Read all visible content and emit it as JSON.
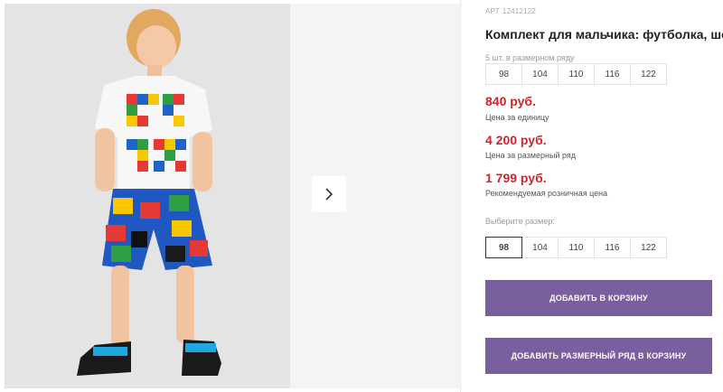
{
  "product": {
    "art_label": "АРТ",
    "art_number": "12412122",
    "title": "Комплект для мальчика: футболка, шорты",
    "row_note": "5 шт. в размерном ряду",
    "row_sizes": [
      "98",
      "104",
      "110",
      "116",
      "122"
    ]
  },
  "prices": {
    "unit_price": "840 руб.",
    "unit_label": "Цена за единицу",
    "row_price": "4 200 руб.",
    "row_label": "Цена за размерный ряд",
    "retail_price": "1 799 руб.",
    "retail_label": "Рекомендуемая розничная цена"
  },
  "size_select": {
    "label": "Выберите размер:",
    "options": [
      "98",
      "104",
      "110",
      "116",
      "122"
    ],
    "selected": "98"
  },
  "buttons": {
    "add_to_cart": "ДОБАВИТЬ В КОРЗИНУ",
    "add_row_to_cart": "ДОБАВИТЬ РАЗМЕРНЫЙ РЯД В КОРЗИНУ"
  },
  "gallery": {
    "next_icon": "chevron-right-icon"
  },
  "colors": {
    "accent": "#7a5f9e",
    "price": "#d2232a"
  }
}
